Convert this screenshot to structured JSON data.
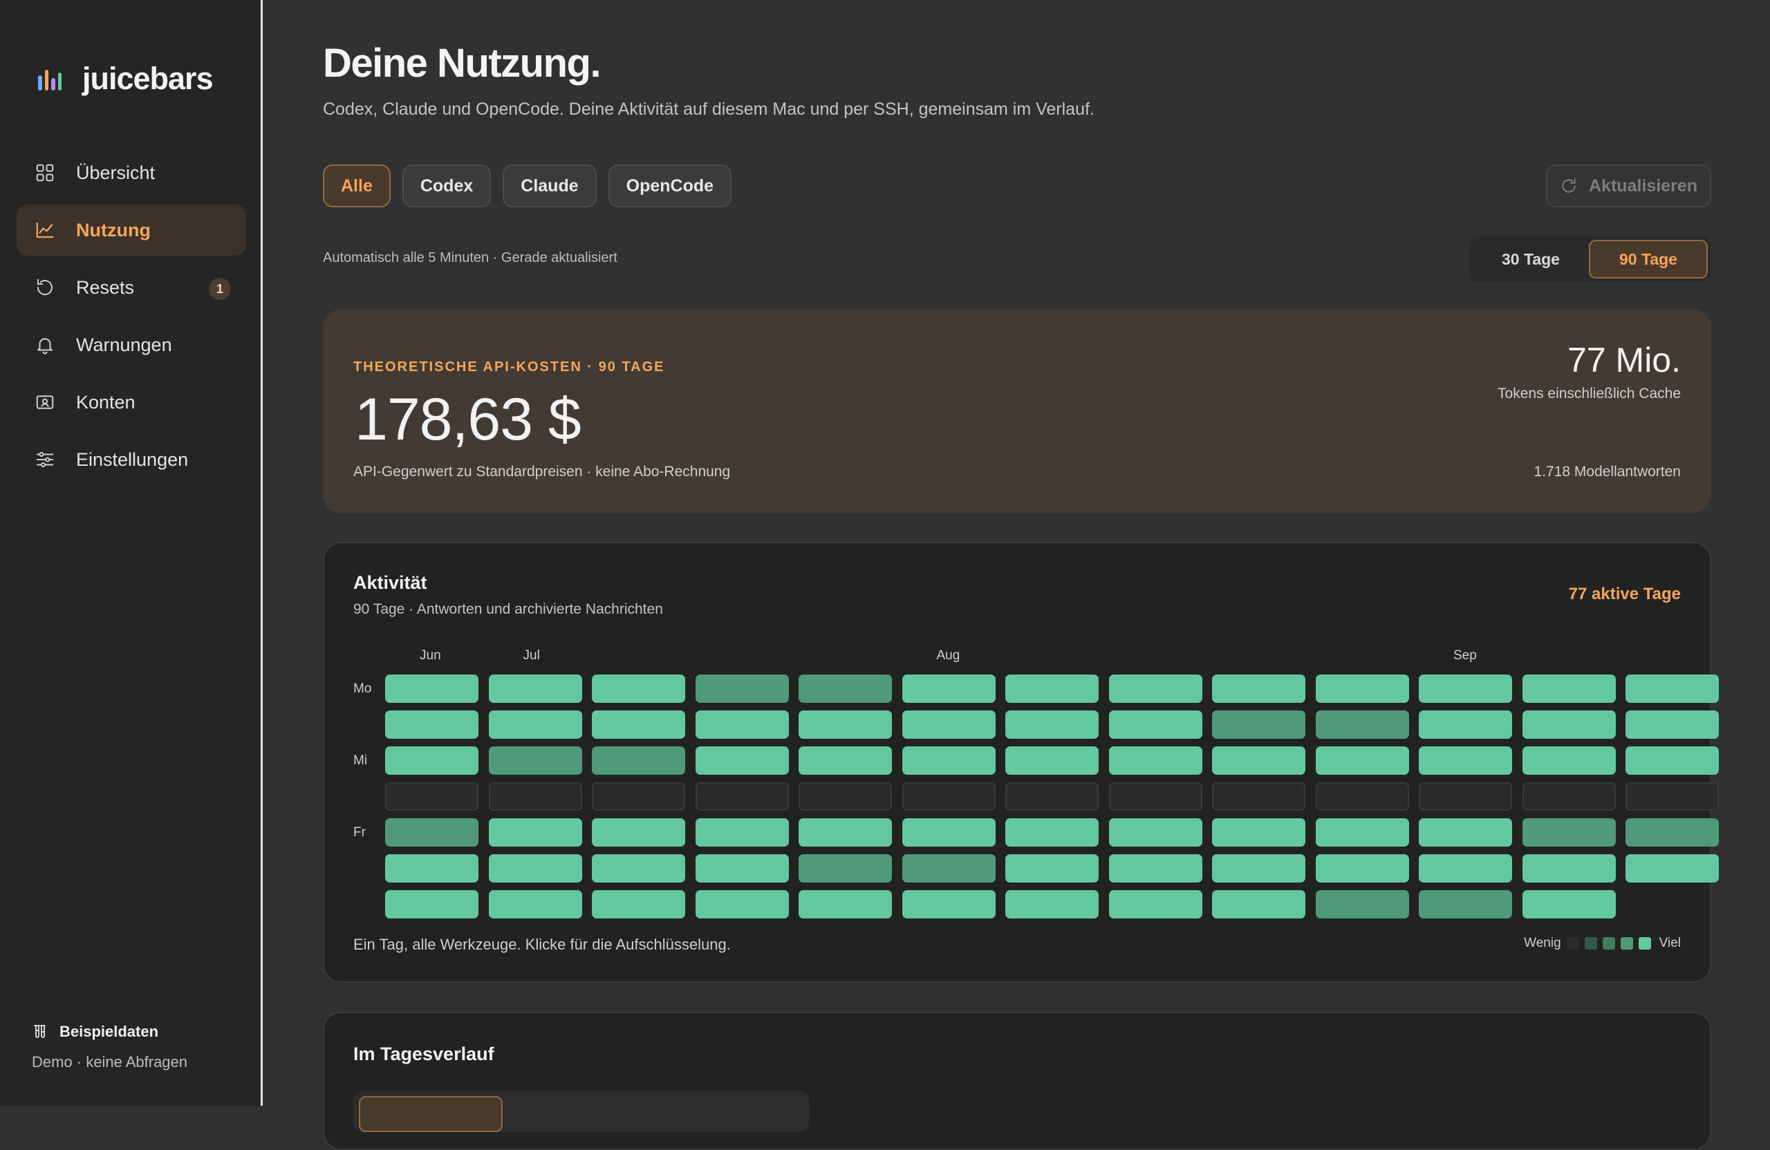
{
  "app": {
    "name": "juicebars"
  },
  "sidebar": {
    "items": [
      {
        "label": "Übersicht",
        "icon": "grid-icon"
      },
      {
        "label": "Nutzung",
        "icon": "chart-line-icon",
        "active": true
      },
      {
        "label": "Resets",
        "icon": "reset-icon",
        "badge": "1"
      },
      {
        "label": "Warnungen",
        "icon": "bell-icon"
      },
      {
        "label": "Konten",
        "icon": "account-card-icon"
      },
      {
        "label": "Einstellungen",
        "icon": "sliders-icon"
      }
    ],
    "footer": {
      "title": "Beispieldaten",
      "subtitle": "Demo · keine Abfragen"
    }
  },
  "header": {
    "title": "Deine Nutzung.",
    "subtitle": "Codex, Claude und OpenCode. Deine Aktivität auf diesem Mac und per SSH, gemeinsam im Verlauf."
  },
  "filters": [
    {
      "label": "Alle",
      "active": true
    },
    {
      "label": "Codex"
    },
    {
      "label": "Claude"
    },
    {
      "label": "OpenCode"
    }
  ],
  "refresh_label": "Aktualisieren",
  "auto_note": "Automatisch alle 5 Minuten · Gerade aktualisiert",
  "range": {
    "options": [
      "30 Tage",
      "90 Tage"
    ],
    "selected": "90 Tage"
  },
  "cost": {
    "label": "THEORETISCHE API-KOSTEN · 90 TAGE",
    "value": "178,63 $",
    "note": "API-Gegenwert zu Standardpreisen · keine Abo-Rechnung",
    "tokens_value": "77 Mio.",
    "tokens_note": "Tokens einschließlich Cache",
    "responses_note": "1.718 Modellantworten"
  },
  "activity": {
    "title": "Aktivität",
    "subtitle": "90 Tage · Antworten und archivierte Nachrichten",
    "active_days": "77 aktive Tage",
    "months": [
      {
        "label": "Jun",
        "week": 0
      },
      {
        "label": "Jul",
        "week": 1
      },
      {
        "label": "Aug",
        "week": 5
      },
      {
        "label": "Sep",
        "week": 10
      }
    ],
    "day_labels": [
      {
        "label": "Mo",
        "row": 0
      },
      {
        "label": "Mi",
        "row": 2
      },
      {
        "label": "Fr",
        "row": 4
      }
    ],
    "weeks": 13,
    "levels": [
      [
        4,
        4,
        4,
        3,
        3,
        4,
        4,
        4,
        4,
        4,
        4,
        4,
        4
      ],
      [
        4,
        4,
        4,
        4,
        4,
        4,
        4,
        4,
        3,
        3,
        4,
        4,
        4
      ],
      [
        4,
        3,
        3,
        4,
        4,
        4,
        4,
        4,
        4,
        4,
        4,
        4,
        4
      ],
      [
        0,
        0,
        0,
        0,
        0,
        0,
        0,
        0,
        0,
        0,
        0,
        0,
        0
      ],
      [
        3,
        4,
        4,
        4,
        4,
        4,
        4,
        4,
        4,
        4,
        4,
        3,
        3
      ],
      [
        4,
        4,
        4,
        4,
        3,
        3,
        4,
        4,
        4,
        4,
        4,
        4,
        4
      ],
      [
        4,
        4,
        4,
        4,
        4,
        4,
        4,
        4,
        4,
        3,
        3,
        4,
        null
      ]
    ],
    "footer": "Ein Tag, alle Werkzeuge. Klicke für die Aufschlüsselung.",
    "legend": {
      "low": "Wenig",
      "high": "Viel",
      "colors": [
        "#2b2b2b",
        "#2f5a48",
        "#3f7d63",
        "#4f9a7a",
        "#63c8a0"
      ]
    }
  },
  "daily": {
    "title": "Im Tagesverlauf"
  },
  "colors": {
    "accent": "#f5a659",
    "heat_high": "#63c8a0",
    "heat_mid": "#4f9a7a"
  }
}
